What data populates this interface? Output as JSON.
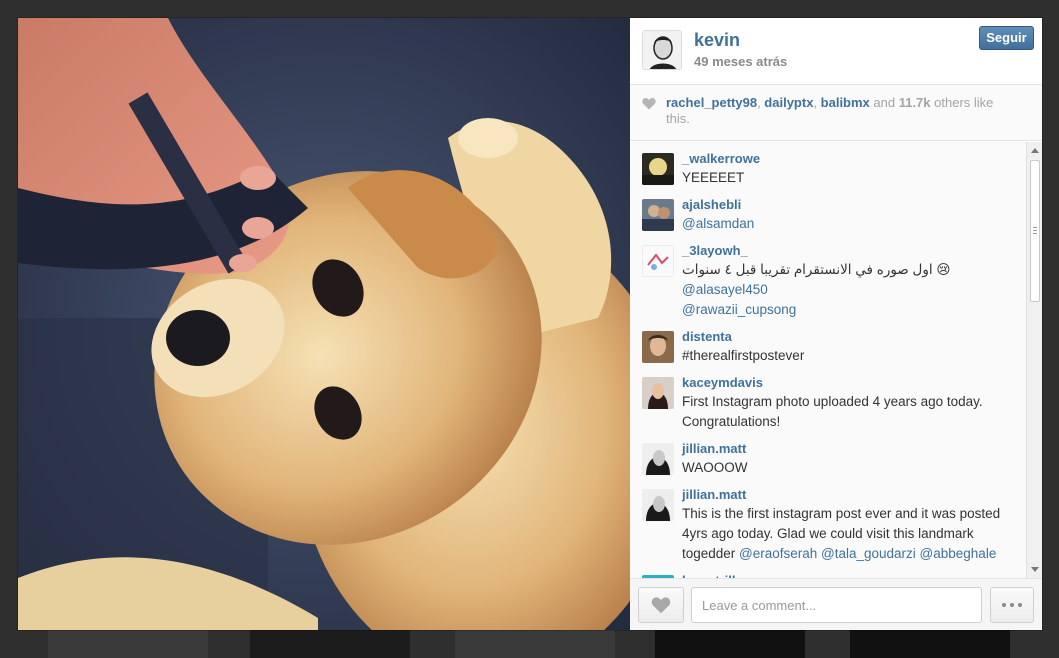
{
  "post": {
    "username": "kevin",
    "time": "49 meses atrás",
    "follow_label": "Seguir"
  },
  "likes": {
    "users": [
      "rachel_petty98",
      "dailyptx",
      "balibmx"
    ],
    "sep1": ", ",
    "sep2": ", ",
    "and_text": " and ",
    "count": "11.7k",
    "suffix": " others like this."
  },
  "comments": [
    {
      "user": "_walkerrowe",
      "text": "YEEEEET",
      "mentions": ""
    },
    {
      "user": "ajalshebli",
      "text": "",
      "mentions": "@alsamdan"
    },
    {
      "user": "_3layowh_",
      "text": "اول صوره في الانستقرام تقريبا قبل ٤ سنوات 😢",
      "mentions": " @alasayel450",
      "mentions2": "@rawazii_cupsong"
    },
    {
      "user": "distenta",
      "text": "#therealfirstpostever",
      "mentions": ""
    },
    {
      "user": "kaceymdavis",
      "text": "First Instagram photo uploaded 4 years ago today. Congratulations!",
      "mentions": ""
    },
    {
      "user": "jillian.matt",
      "text": "WAOOOW",
      "mentions": ""
    },
    {
      "user": "jillian.matt",
      "text": "This is the first instagram post ever and it was posted 4yrs ago today. Glad we could visit this landmark togedder ",
      "mentions": "@eraofserah @tala_goudarzi @abbeghale"
    },
    {
      "user": "lucastrillog",
      "text": "",
      "mentions": ""
    }
  ],
  "footer": {
    "comment_placeholder": "Leave a comment..."
  },
  "icons": {
    "like": "heart-icon",
    "more": "more-dots-icon"
  },
  "colors": {
    "link": "#3f729b",
    "follow_button": "#4a79a3"
  }
}
